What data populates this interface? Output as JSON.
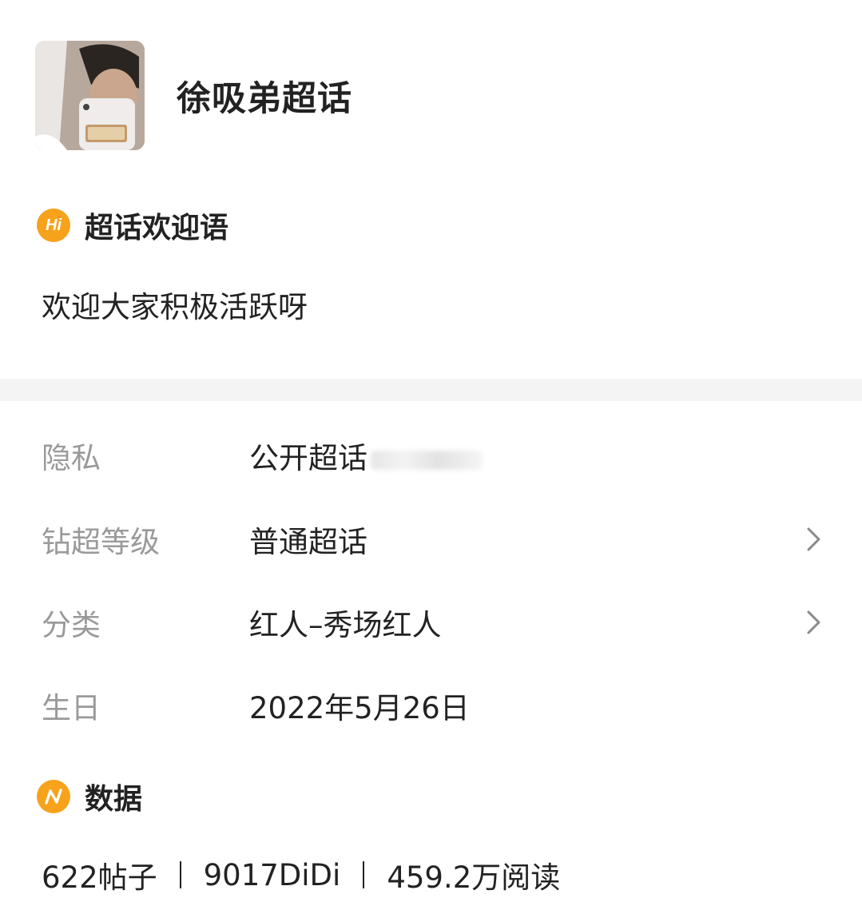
{
  "header": {
    "avatar_alt": "avatar",
    "title": "徐吸弟超话"
  },
  "welcome": {
    "icon_text": "Hi",
    "heading": "超话欢迎语",
    "text": "欢迎大家积极活跃呀"
  },
  "info": {
    "rows": [
      {
        "label": "隐私",
        "value": "公开超话"
      },
      {
        "label": "钻超等级",
        "value": "普通超话"
      },
      {
        "label": "分类",
        "value": "红人–秀场红人"
      },
      {
        "label": "生日",
        "value": "2022年5月26日"
      }
    ]
  },
  "data_section": {
    "heading": "数据",
    "stats": [
      "622帖子",
      "9017DiDi",
      "459.2万阅读"
    ]
  },
  "colors": {
    "accent": "#f7a21b",
    "label_gray": "#9a9a9a",
    "divider": "#f4f4f4"
  }
}
